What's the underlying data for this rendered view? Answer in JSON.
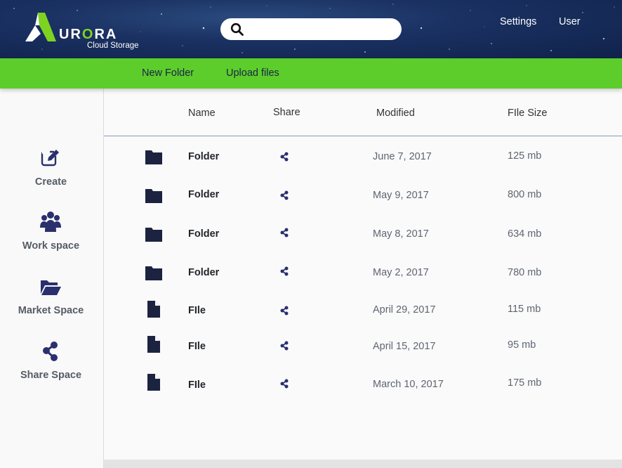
{
  "brand": {
    "name_prefix": "UR",
    "name_accent": "O",
    "name_suffix": "RA",
    "subtitle": "Cloud Storage",
    "accent_color": "#7ed321"
  },
  "search": {
    "placeholder": "",
    "value": "",
    "icon": "search-icon"
  },
  "top_nav": {
    "settings": "Settings",
    "user": "User"
  },
  "toolbar": {
    "new_folder": "New Folder",
    "upload_files": "Upload files",
    "color": "#5ccd2b"
  },
  "sidebar": {
    "items": [
      {
        "label": "Create",
        "icon": "edit-icon"
      },
      {
        "label": "Work space",
        "icon": "users-icon"
      },
      {
        "label": "Market Space",
        "icon": "folder-open-icon"
      },
      {
        "label": "Share Space",
        "icon": "share-icon"
      }
    ]
  },
  "table": {
    "headers": {
      "name": "Name",
      "share": "Share",
      "modified": "Modified",
      "size": "FIle Size"
    },
    "rows": [
      {
        "type": "folder",
        "name": "Folder",
        "modified": "June 7, 2017",
        "size": "125 mb"
      },
      {
        "type": "folder",
        "name": "Folder",
        "modified": "May 9, 2017",
        "size": "800 mb"
      },
      {
        "type": "folder",
        "name": "Folder",
        "modified": "May 8, 2017",
        "size": "634 mb"
      },
      {
        "type": "folder",
        "name": "Folder",
        "modified": "May 2, 2017",
        "size": "780 mb"
      },
      {
        "type": "file",
        "name": "FIle",
        "modified": "April 29, 2017",
        "size": "115 mb"
      },
      {
        "type": "file",
        "name": "FIle",
        "modified": "April 15, 2017",
        "size": "95 mb"
      },
      {
        "type": "file",
        "name": "FIle",
        "modified": "March 10, 2017",
        "size": "175 mb"
      }
    ]
  },
  "colors": {
    "header_dark": "#10224a",
    "icon_navy": "#2a2f6e",
    "row_icon": "#1b2340"
  }
}
